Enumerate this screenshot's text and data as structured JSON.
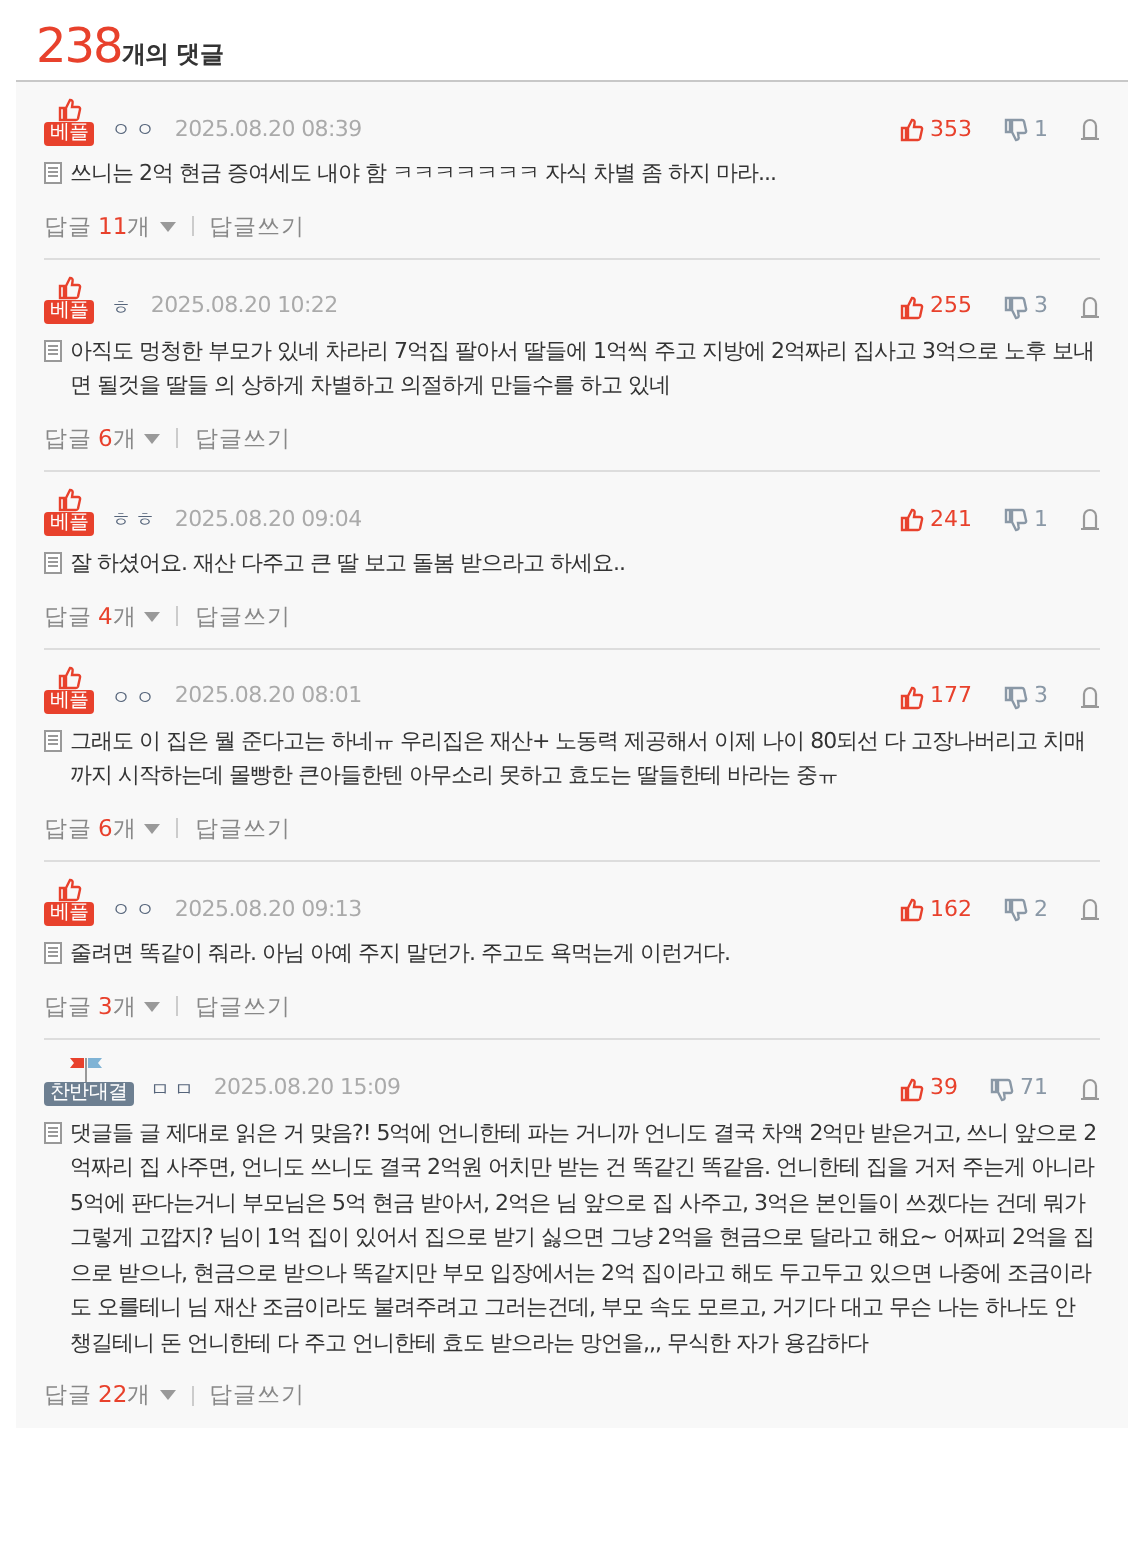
{
  "header": {
    "count": "238",
    "label": "개의 댓글"
  },
  "comments": [
    {
      "badge": {
        "kind": "best",
        "label": "베플"
      },
      "user": "ㅇㅇ",
      "date": "2025.08.20 08:39",
      "likes": "353",
      "dislikes": "1",
      "text": "쓰니는 2억 현금 증여세도 내야 함 ㅋㅋㅋㅋㅋㅋㅋ 자식 차별 좀 하지 마라...",
      "reply_label": "답글",
      "reply_count": "11",
      "reply_unit": "개",
      "write_reply": "답글쓰기"
    },
    {
      "badge": {
        "kind": "best",
        "label": "베플"
      },
      "user": "ㅎ",
      "date": "2025.08.20 10:22",
      "likes": "255",
      "dislikes": "3",
      "text": "아직도 멍청한 부모가 있네 차라리 7억집 팔아서 딸들에 1억씩 주고 지방에 2억짜리 집사고 3억으로 노후 보내면 될것을 딸들 의 상하게 차별하고 의절하게 만들수를 하고 있네",
      "reply_label": "답글",
      "reply_count": "6",
      "reply_unit": "개",
      "write_reply": "답글쓰기"
    },
    {
      "badge": {
        "kind": "best",
        "label": "베플"
      },
      "user": "ㅎㅎ",
      "date": "2025.08.20 09:04",
      "likes": "241",
      "dislikes": "1",
      "text": "잘 하셨어요. 재산 다주고 큰 딸 보고 돌봄 받으라고 하세요..",
      "reply_label": "답글",
      "reply_count": "4",
      "reply_unit": "개",
      "write_reply": "답글쓰기"
    },
    {
      "badge": {
        "kind": "best",
        "label": "베플"
      },
      "user": "ㅇㅇ",
      "date": "2025.08.20 08:01",
      "likes": "177",
      "dislikes": "3",
      "text": "그래도 이 집은 뭘 준다고는 하네ㅠ 우리집은 재산+ 노동력 제공해서 이제 나이 80되선 다 고장나버리고 치매까지 시작하는데 몰빵한 큰아들한텐 아무소리 못하고 효도는 딸들한테 바라는 중ㅠ",
      "reply_label": "답글",
      "reply_count": "6",
      "reply_unit": "개",
      "write_reply": "답글쓰기"
    },
    {
      "badge": {
        "kind": "best",
        "label": "베플"
      },
      "user": "ㅇㅇ",
      "date": "2025.08.20 09:13",
      "likes": "162",
      "dislikes": "2",
      "text": "줄려면 똑같이 줘라. 아님 아예 주지 말던가. 주고도 욕먹는게 이런거다.",
      "reply_label": "답글",
      "reply_count": "3",
      "reply_unit": "개",
      "write_reply": "답글쓰기"
    },
    {
      "badge": {
        "kind": "debate",
        "label": "찬반대결"
      },
      "user": "ㅁㅁ",
      "date": "2025.08.20 15:09",
      "likes": "39",
      "dislikes": "71",
      "text": "댓글들 글 제대로 읽은 거 맞음?! 5억에 언니한테 파는 거니까 언니도 결국 차액 2억만 받은거고, 쓰니 앞으로 2억짜리 집 사주면, 언니도 쓰니도 결국 2억원 어치만 받는 건 똑같긴 똑같음. 언니한테 집을 거저 주는게 아니라 5억에 판다는거니 부모님은 5억 현금 받아서, 2억은 님 앞으로 집 사주고, 3억은 본인들이 쓰겠다는 건데 뭐가 그렇게 고깝지? 님이 1억 집이 있어서 집으로 받기 싫으면 그냥 2억을 현금으로 달라고 해요~ 어짜피 2억을 집으로 받으나, 현금으로 받으나 똑같지만 부모 입장에서는 2억 집이라고 해도 두고두고 있으면 나중에 조금이라도 오를테니 님 재산 조금이라도 불려주려고 그러는건데, 부모 속도 모르고, 거기다 대고 무슨 나는 하나도 안 챙길테니 돈 언니한테 다 주고 언니한테 효도 받으라는 망언을,,, 무식한 자가 용감하다",
      "reply_label": "답글",
      "reply_count": "22",
      "reply_unit": "개",
      "write_reply": "답글쓰기"
    }
  ]
}
